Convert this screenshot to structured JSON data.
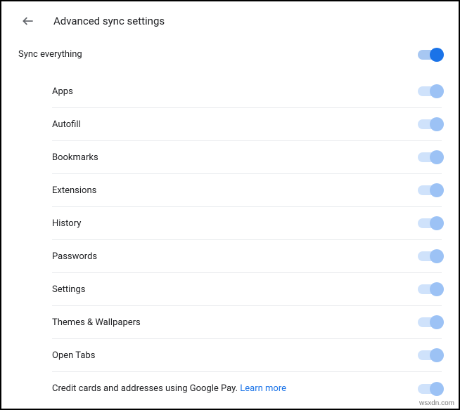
{
  "header": {
    "title": "Advanced sync settings"
  },
  "master": {
    "label": "Sync everything",
    "on": true,
    "enabled": true
  },
  "items": [
    {
      "label": "Apps",
      "on": true,
      "enabled": false
    },
    {
      "label": "Autofill",
      "on": true,
      "enabled": false
    },
    {
      "label": "Bookmarks",
      "on": true,
      "enabled": false
    },
    {
      "label": "Extensions",
      "on": true,
      "enabled": false
    },
    {
      "label": "History",
      "on": true,
      "enabled": false
    },
    {
      "label": "Passwords",
      "on": true,
      "enabled": false
    },
    {
      "label": "Settings",
      "on": true,
      "enabled": false
    },
    {
      "label": "Themes & Wallpapers",
      "on": true,
      "enabled": false
    },
    {
      "label": "Open Tabs",
      "on": true,
      "enabled": false
    },
    {
      "label": "Credit cards and addresses using Google Pay. ",
      "link": "Learn more",
      "on": true,
      "enabled": false
    }
  ],
  "watermark": "wsxdn.com"
}
